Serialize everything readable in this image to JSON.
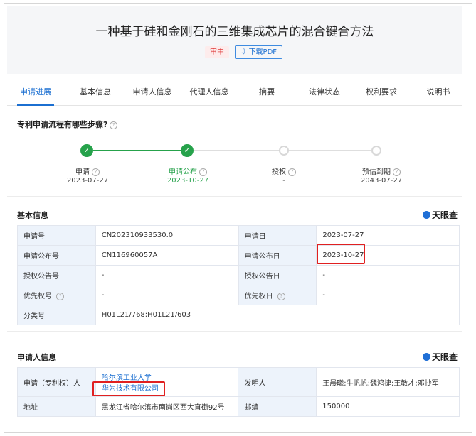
{
  "header": {
    "title": "一种基于硅和金刚石的三维集成芯片的混合键合方法",
    "status_badge": "审中",
    "pdf_button": "下载PDF"
  },
  "tabs": [
    "申请进展",
    "基本信息",
    "申请人信息",
    "代理人信息",
    "摘要",
    "法律状态",
    "权利要求",
    "说明书"
  ],
  "process": {
    "question": "专利申请流程有哪些步骤?",
    "steps": [
      {
        "label": "申请",
        "date": "2023-07-27",
        "done": true
      },
      {
        "label": "申请公布",
        "date": "2023-10-27",
        "done": true
      },
      {
        "label": "授权",
        "date": "-",
        "done": false
      },
      {
        "label": "预估到期",
        "date": "2043-07-27",
        "done": false
      }
    ]
  },
  "basic_info": {
    "title": "基本信息",
    "brand": "天眼查",
    "rows": [
      {
        "k1": "申请号",
        "v1": "CN202310933530.0",
        "k2": "申请日",
        "v2": "2023-07-27"
      },
      {
        "k1": "申请公布号",
        "v1": "CN116960057A",
        "k2": "申请公布日",
        "v2": "2023-10-27"
      },
      {
        "k1": "授权公告号",
        "v1": "-",
        "k2": "授权公告日",
        "v2": "-"
      },
      {
        "k1": "优先权号",
        "v1": "-",
        "k2": "优先权日",
        "v2": "-"
      },
      {
        "k1": "分类号",
        "v1": "H01L21/768;H01L21/603"
      }
    ]
  },
  "applicant_info": {
    "title": "申请人信息",
    "brand": "天眼查",
    "applicant_key": "申请（专利权）人",
    "applicants": [
      "哈尔滨工业大学",
      "华为技术有限公司"
    ],
    "inventor_key": "发明人",
    "inventors": "王晨曦;牛帆帆;魏鸿捷;王敏才;邓抄军",
    "address_key": "地址",
    "address": "黑龙江省哈尔滨市南岗区西大直街92号",
    "zip_key": "邮编",
    "zip": "150000"
  },
  "colors": {
    "accent": "#1b6fd1",
    "done": "#26a24b",
    "status": "#e03c3c",
    "highlight": "#e02020"
  }
}
